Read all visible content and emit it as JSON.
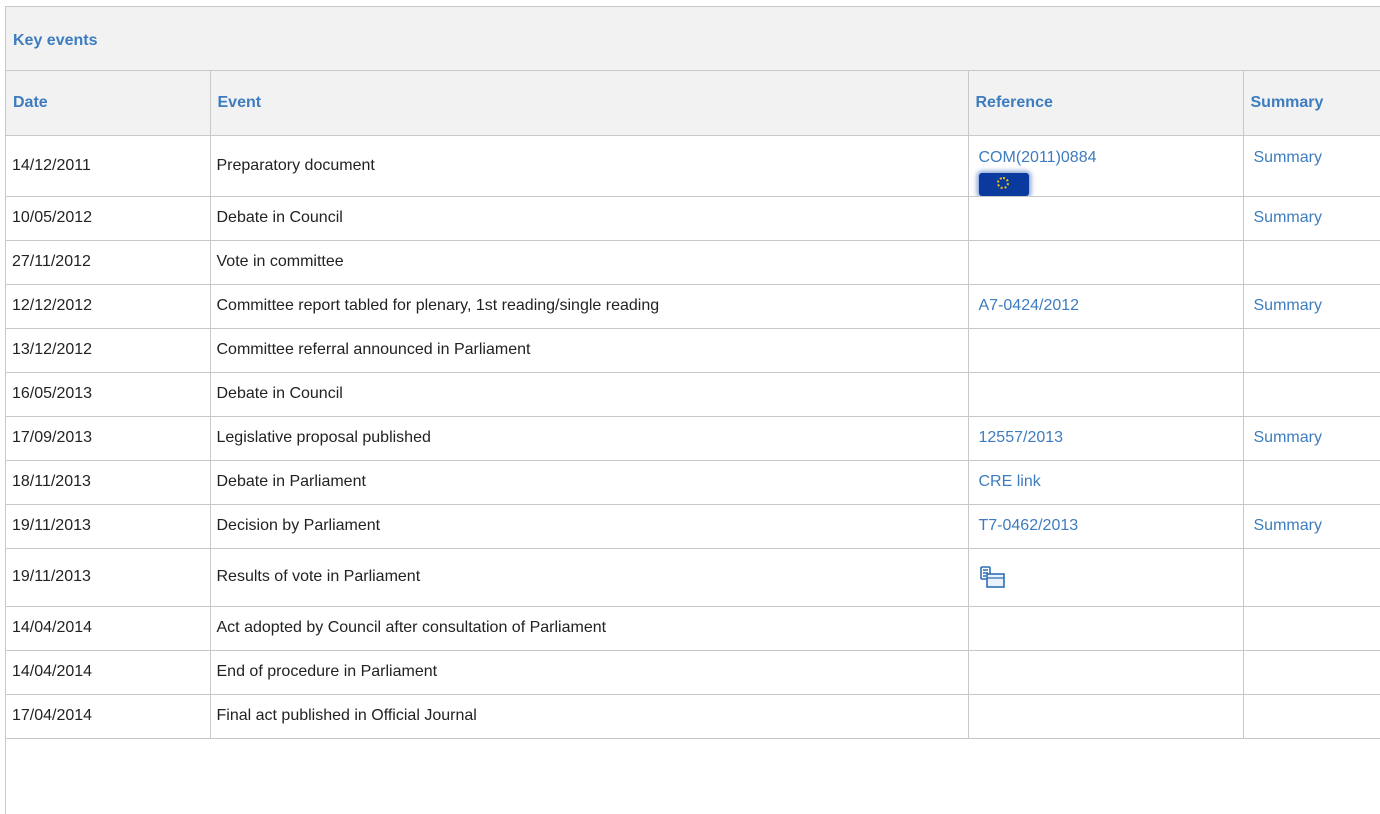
{
  "section": {
    "title": "Key events"
  },
  "table": {
    "headers": [
      "Date",
      "Event",
      "Reference",
      "Summary"
    ],
    "rows": [
      {
        "date": "14/12/2011",
        "event": "Preparatory document",
        "reference": "COM(2011)0884",
        "reference_icon": "eu-flag-icon",
        "summary": "Summary"
      },
      {
        "date": "10/05/2012",
        "event": "Debate in Council",
        "reference": "",
        "summary": "Summary"
      },
      {
        "date": "27/11/2012",
        "event": "Vote in committee",
        "reference": "",
        "summary": ""
      },
      {
        "date": "12/12/2012",
        "event": "Committee report tabled for plenary, 1st reading/single reading",
        "reference": "A7-0424/2012",
        "summary": "Summary"
      },
      {
        "date": "13/12/2012",
        "event": "Committee referral announced in Parliament",
        "reference": "",
        "summary": ""
      },
      {
        "date": "16/05/2013",
        "event": "Debate in Council",
        "reference": "",
        "summary": ""
      },
      {
        "date": "17/09/2013",
        "event": "Legislative proposal published",
        "reference": "12557/2013",
        "summary": "Summary"
      },
      {
        "date": "18/11/2013",
        "event": "Debate in Parliament",
        "reference": "CRE link",
        "summary": ""
      },
      {
        "date": "19/11/2013",
        "event": "Decision by Parliament",
        "reference": "T7-0462/2013",
        "summary": "Summary"
      },
      {
        "date": "19/11/2013",
        "event": "Results of vote in Parliament",
        "reference": "",
        "reference_icon": "vote-results-icon",
        "summary": ""
      },
      {
        "date": "14/04/2014",
        "event": "Act adopted by Council after consultation of Parliament",
        "reference": "",
        "summary": ""
      },
      {
        "date": "14/04/2014",
        "event": "End of procedure in Parliament",
        "reference": "",
        "summary": ""
      },
      {
        "date": "17/04/2014",
        "event": "Final act published in Official Journal",
        "reference": "",
        "summary": ""
      }
    ]
  },
  "colors": {
    "link": "#3d7cbf",
    "header_bg": "#f2f2f2",
    "border": "#c8c8c8",
    "text": "#222222"
  }
}
